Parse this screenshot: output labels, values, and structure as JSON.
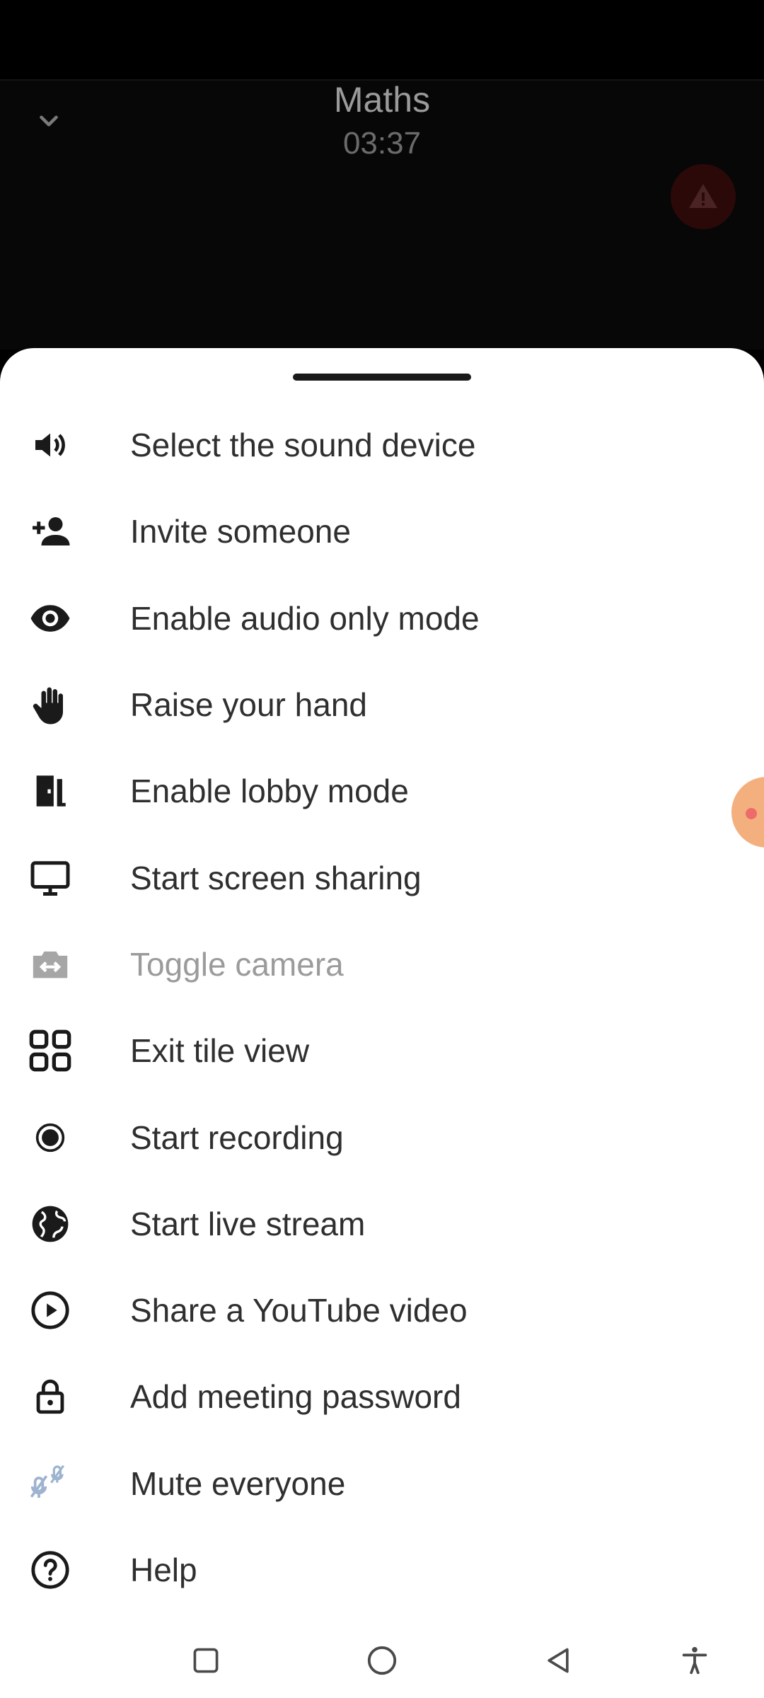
{
  "header": {
    "title": "Maths",
    "timer": "03:37"
  },
  "menu": {
    "items": [
      {
        "label": "Select the sound device",
        "icon": "volume-icon"
      },
      {
        "label": "Invite someone",
        "icon": "add-person-icon"
      },
      {
        "label": "Enable audio only mode",
        "icon": "eye-icon"
      },
      {
        "label": "Raise your hand",
        "icon": "hand-icon"
      },
      {
        "label": "Enable lobby mode",
        "icon": "door-icon"
      },
      {
        "label": "Start screen sharing",
        "icon": "monitor-icon"
      },
      {
        "label": "Toggle camera",
        "icon": "switch-camera-icon",
        "disabled": true
      },
      {
        "label": "Exit tile view",
        "icon": "tile-grid-icon"
      },
      {
        "label": "Start recording",
        "icon": "record-icon"
      },
      {
        "label": "Start live stream",
        "icon": "globe-icon"
      },
      {
        "label": "Share a YouTube video",
        "icon": "play-circle-icon"
      },
      {
        "label": "Add meeting password",
        "icon": "lock-icon"
      },
      {
        "label": "Mute everyone",
        "icon": "mic-off-icon"
      },
      {
        "label": "Help",
        "icon": "help-icon"
      }
    ]
  },
  "colors": {
    "sheet_background": "#ffffff",
    "text": "#2f2f2f",
    "disabled_text": "#9b9b9b",
    "icon": "#1a1a1a",
    "warning_badge": "#2b0909",
    "floating_bubble": "#f3b07e"
  },
  "navbar": {
    "buttons": [
      "recents-icon",
      "home-icon",
      "back-icon",
      "accessibility-icon"
    ]
  }
}
